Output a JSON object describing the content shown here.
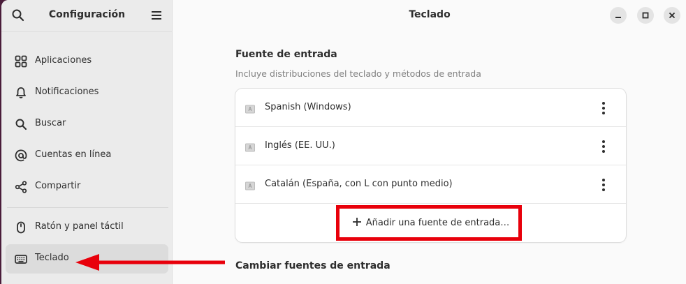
{
  "sidebar": {
    "title": "Configuración",
    "items": [
      {
        "label": "Aplicaciones",
        "icon": "apps-grid-icon"
      },
      {
        "label": "Notificaciones",
        "icon": "bell-icon"
      },
      {
        "label": "Buscar",
        "icon": "search-icon"
      },
      {
        "label": "Cuentas en línea",
        "icon": "at-icon"
      },
      {
        "label": "Compartir",
        "icon": "share-icon"
      },
      {
        "label": "Ratón y panel táctil",
        "icon": "mouse-icon"
      },
      {
        "label": "Teclado",
        "icon": "keyboard-icon",
        "selected": true
      }
    ]
  },
  "main": {
    "title": "Teclado",
    "section1": {
      "title": "Fuente de entrada",
      "subtitle": "Incluye distribuciones del teclado y métodos de entrada",
      "sources": [
        {
          "label": "Spanish (Windows)"
        },
        {
          "label": "Inglés (EE. UU.)"
        },
        {
          "label": "Catalán (España, con L con punto medio)"
        }
      ],
      "add_label": "Añadir una fuente de entrada…"
    },
    "section2": {
      "title": "Cambiar fuentes de entrada"
    }
  },
  "colors": {
    "highlight": "#e8000b",
    "sidebar_bg": "#ebebeb",
    "selected_bg": "#dcdcdc"
  }
}
